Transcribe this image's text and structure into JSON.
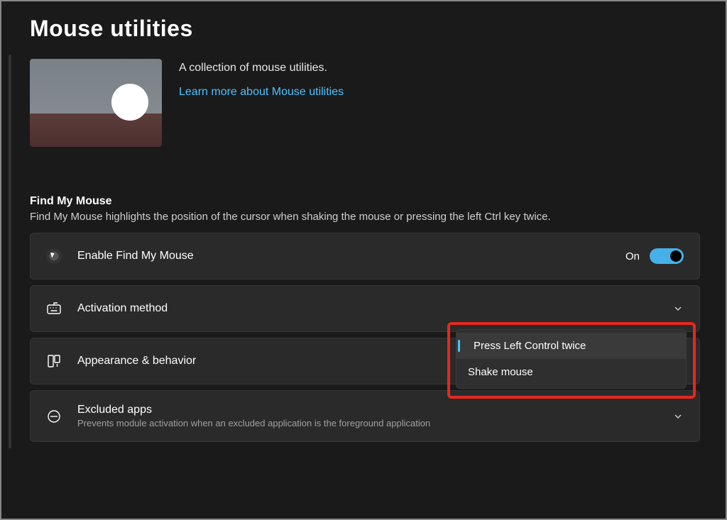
{
  "page": {
    "title": "Mouse utilities"
  },
  "hero": {
    "description": "A collection of mouse utilities.",
    "link_text": "Learn more about Mouse utilities"
  },
  "section": {
    "title": "Find My Mouse",
    "description": "Find My Mouse highlights the position of the cursor when shaking the mouse or pressing the left Ctrl key twice."
  },
  "cards": {
    "enable": {
      "title": "Enable Find My Mouse",
      "toggle_state": "On"
    },
    "activation": {
      "title": "Activation method",
      "options": [
        "Press Left Control twice",
        "Shake mouse"
      ]
    },
    "appearance": {
      "title": "Appearance & behavior"
    },
    "excluded": {
      "title": "Excluded apps",
      "subtitle": "Prevents module activation when an excluded application is the foreground application"
    }
  }
}
